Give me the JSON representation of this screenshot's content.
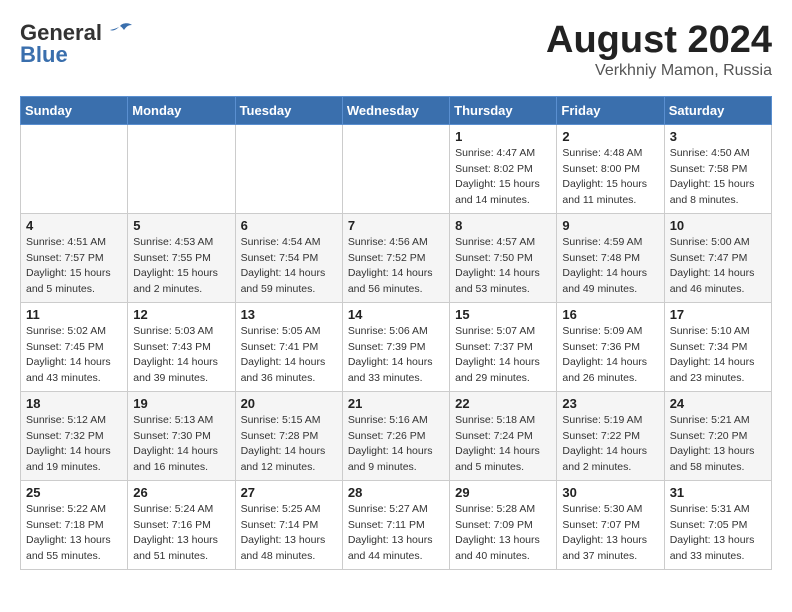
{
  "logo": {
    "line1": "General",
    "line2": "Blue"
  },
  "header": {
    "month": "August 2024",
    "location": "Verkhniy Mamon, Russia"
  },
  "weekdays": [
    "Sunday",
    "Monday",
    "Tuesday",
    "Wednesday",
    "Thursday",
    "Friday",
    "Saturday"
  ],
  "weeks": [
    [
      {
        "day": "",
        "info": ""
      },
      {
        "day": "",
        "info": ""
      },
      {
        "day": "",
        "info": ""
      },
      {
        "day": "",
        "info": ""
      },
      {
        "day": "1",
        "info": "Sunrise: 4:47 AM\nSunset: 8:02 PM\nDaylight: 15 hours\nand 14 minutes."
      },
      {
        "day": "2",
        "info": "Sunrise: 4:48 AM\nSunset: 8:00 PM\nDaylight: 15 hours\nand 11 minutes."
      },
      {
        "day": "3",
        "info": "Sunrise: 4:50 AM\nSunset: 7:58 PM\nDaylight: 15 hours\nand 8 minutes."
      }
    ],
    [
      {
        "day": "4",
        "info": "Sunrise: 4:51 AM\nSunset: 7:57 PM\nDaylight: 15 hours\nand 5 minutes."
      },
      {
        "day": "5",
        "info": "Sunrise: 4:53 AM\nSunset: 7:55 PM\nDaylight: 15 hours\nand 2 minutes."
      },
      {
        "day": "6",
        "info": "Sunrise: 4:54 AM\nSunset: 7:54 PM\nDaylight: 14 hours\nand 59 minutes."
      },
      {
        "day": "7",
        "info": "Sunrise: 4:56 AM\nSunset: 7:52 PM\nDaylight: 14 hours\nand 56 minutes."
      },
      {
        "day": "8",
        "info": "Sunrise: 4:57 AM\nSunset: 7:50 PM\nDaylight: 14 hours\nand 53 minutes."
      },
      {
        "day": "9",
        "info": "Sunrise: 4:59 AM\nSunset: 7:48 PM\nDaylight: 14 hours\nand 49 minutes."
      },
      {
        "day": "10",
        "info": "Sunrise: 5:00 AM\nSunset: 7:47 PM\nDaylight: 14 hours\nand 46 minutes."
      }
    ],
    [
      {
        "day": "11",
        "info": "Sunrise: 5:02 AM\nSunset: 7:45 PM\nDaylight: 14 hours\nand 43 minutes."
      },
      {
        "day": "12",
        "info": "Sunrise: 5:03 AM\nSunset: 7:43 PM\nDaylight: 14 hours\nand 39 minutes."
      },
      {
        "day": "13",
        "info": "Sunrise: 5:05 AM\nSunset: 7:41 PM\nDaylight: 14 hours\nand 36 minutes."
      },
      {
        "day": "14",
        "info": "Sunrise: 5:06 AM\nSunset: 7:39 PM\nDaylight: 14 hours\nand 33 minutes."
      },
      {
        "day": "15",
        "info": "Sunrise: 5:07 AM\nSunset: 7:37 PM\nDaylight: 14 hours\nand 29 minutes."
      },
      {
        "day": "16",
        "info": "Sunrise: 5:09 AM\nSunset: 7:36 PM\nDaylight: 14 hours\nand 26 minutes."
      },
      {
        "day": "17",
        "info": "Sunrise: 5:10 AM\nSunset: 7:34 PM\nDaylight: 14 hours\nand 23 minutes."
      }
    ],
    [
      {
        "day": "18",
        "info": "Sunrise: 5:12 AM\nSunset: 7:32 PM\nDaylight: 14 hours\nand 19 minutes."
      },
      {
        "day": "19",
        "info": "Sunrise: 5:13 AM\nSunset: 7:30 PM\nDaylight: 14 hours\nand 16 minutes."
      },
      {
        "day": "20",
        "info": "Sunrise: 5:15 AM\nSunset: 7:28 PM\nDaylight: 14 hours\nand 12 minutes."
      },
      {
        "day": "21",
        "info": "Sunrise: 5:16 AM\nSunset: 7:26 PM\nDaylight: 14 hours\nand 9 minutes."
      },
      {
        "day": "22",
        "info": "Sunrise: 5:18 AM\nSunset: 7:24 PM\nDaylight: 14 hours\nand 5 minutes."
      },
      {
        "day": "23",
        "info": "Sunrise: 5:19 AM\nSunset: 7:22 PM\nDaylight: 14 hours\nand 2 minutes."
      },
      {
        "day": "24",
        "info": "Sunrise: 5:21 AM\nSunset: 7:20 PM\nDaylight: 13 hours\nand 58 minutes."
      }
    ],
    [
      {
        "day": "25",
        "info": "Sunrise: 5:22 AM\nSunset: 7:18 PM\nDaylight: 13 hours\nand 55 minutes."
      },
      {
        "day": "26",
        "info": "Sunrise: 5:24 AM\nSunset: 7:16 PM\nDaylight: 13 hours\nand 51 minutes."
      },
      {
        "day": "27",
        "info": "Sunrise: 5:25 AM\nSunset: 7:14 PM\nDaylight: 13 hours\nand 48 minutes."
      },
      {
        "day": "28",
        "info": "Sunrise: 5:27 AM\nSunset: 7:11 PM\nDaylight: 13 hours\nand 44 minutes."
      },
      {
        "day": "29",
        "info": "Sunrise: 5:28 AM\nSunset: 7:09 PM\nDaylight: 13 hours\nand 40 minutes."
      },
      {
        "day": "30",
        "info": "Sunrise: 5:30 AM\nSunset: 7:07 PM\nDaylight: 13 hours\nand 37 minutes."
      },
      {
        "day": "31",
        "info": "Sunrise: 5:31 AM\nSunset: 7:05 PM\nDaylight: 13 hours\nand 33 minutes."
      }
    ]
  ]
}
